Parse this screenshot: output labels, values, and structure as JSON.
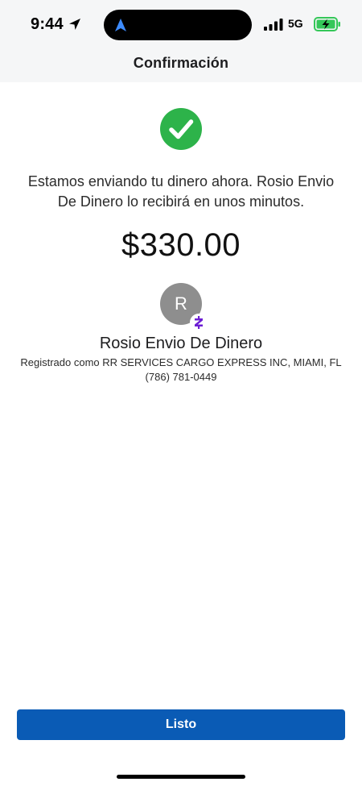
{
  "status_bar": {
    "time": "9:44",
    "network": "5G"
  },
  "header": {
    "title": "Confirmación"
  },
  "confirmation": {
    "message": "Estamos enviando tu dinero ahora. Rosio Envio De Dinero lo recibirá en unos minutos.",
    "amount": "$330.00"
  },
  "recipient": {
    "avatar_initial": "R",
    "name": "Rosio Envio De Dinero",
    "registered": "Registrado como RR SERVICES CARGO EXPRESS INC, MIAMI, FL",
    "phone": "(786) 781-0449"
  },
  "actions": {
    "done_label": "Listo"
  },
  "icons": {
    "success": "checkmark-circle-icon",
    "badge": "zelle-icon",
    "location": "location-arrow-icon"
  },
  "colors": {
    "success_green": "#2db34a",
    "primary_blue": "#0a5bb5",
    "zelle_purple": "#6d1ed4",
    "avatar_gray": "#8e8e8e",
    "battery_green": "#35c759"
  }
}
